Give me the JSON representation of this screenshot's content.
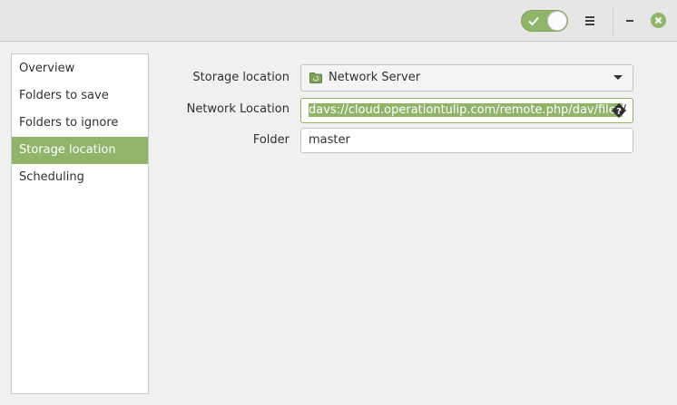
{
  "header": {
    "toggle_on": true,
    "accent_color": "#8fb46a",
    "icons": [
      "check-icon",
      "hamburger-menu-icon",
      "minimize-icon",
      "close-icon"
    ]
  },
  "sidebar": {
    "items": [
      {
        "label": "Overview",
        "selected": false
      },
      {
        "label": "Folders to save",
        "selected": false
      },
      {
        "label": "Folders to ignore",
        "selected": false
      },
      {
        "label": "Storage location",
        "selected": true
      },
      {
        "label": "Scheduling",
        "selected": false
      }
    ]
  },
  "form": {
    "storage_location": {
      "label": "Storage location",
      "value": "Network Server",
      "icon": "folder-icon"
    },
    "network_location": {
      "label": "Network Location",
      "value": "davs://cloud.operationtulip.com/remote.php/dav/files/",
      "visible_selected": "davs://cloud.operationtulip.com/remote.php/dav/files",
      "visible_tail": "/",
      "icon": "help-icon"
    },
    "folder": {
      "label": "Folder",
      "value": "master"
    }
  }
}
